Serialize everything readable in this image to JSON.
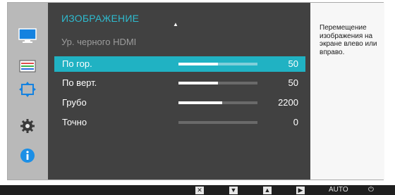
{
  "menu": {
    "title": "ИЗОБРАЖЕНИЕ",
    "scroll_up_glyph": "▲",
    "subtitle": "Ур. черного HDMI",
    "items": [
      {
        "label": "По гор.",
        "value": "50",
        "level": 0.5,
        "selected": true
      },
      {
        "label": "По верт.",
        "value": "50",
        "level": 0.5,
        "selected": false
      },
      {
        "label": "Грубо",
        "value": "2200",
        "level": 0.55,
        "selected": false
      },
      {
        "label": "Точно",
        "value": "0",
        "level": 0.0,
        "selected": false
      }
    ]
  },
  "help": {
    "text": "Перемещение изображения на экране влево или вправо."
  },
  "categories": [
    {
      "icon": "monitor-icon",
      "active": true
    },
    {
      "icon": "color-settings-icon",
      "active": false
    },
    {
      "icon": "size-position-icon",
      "active": false
    },
    {
      "icon": "gear-icon",
      "active": false
    },
    {
      "icon": "info-icon",
      "active": false
    }
  ],
  "buttons": {
    "close_glyph": "✕",
    "down_glyph": "▼",
    "up_glyph": "▲",
    "enter_glyph": "▶",
    "auto_label": "AUTO",
    "power_glyph": "⏻"
  },
  "colors": {
    "accent": "#2ebbcf",
    "selected_row": "#20b2c3",
    "panel": "#414141",
    "info_icon": "#1c8fe6"
  }
}
